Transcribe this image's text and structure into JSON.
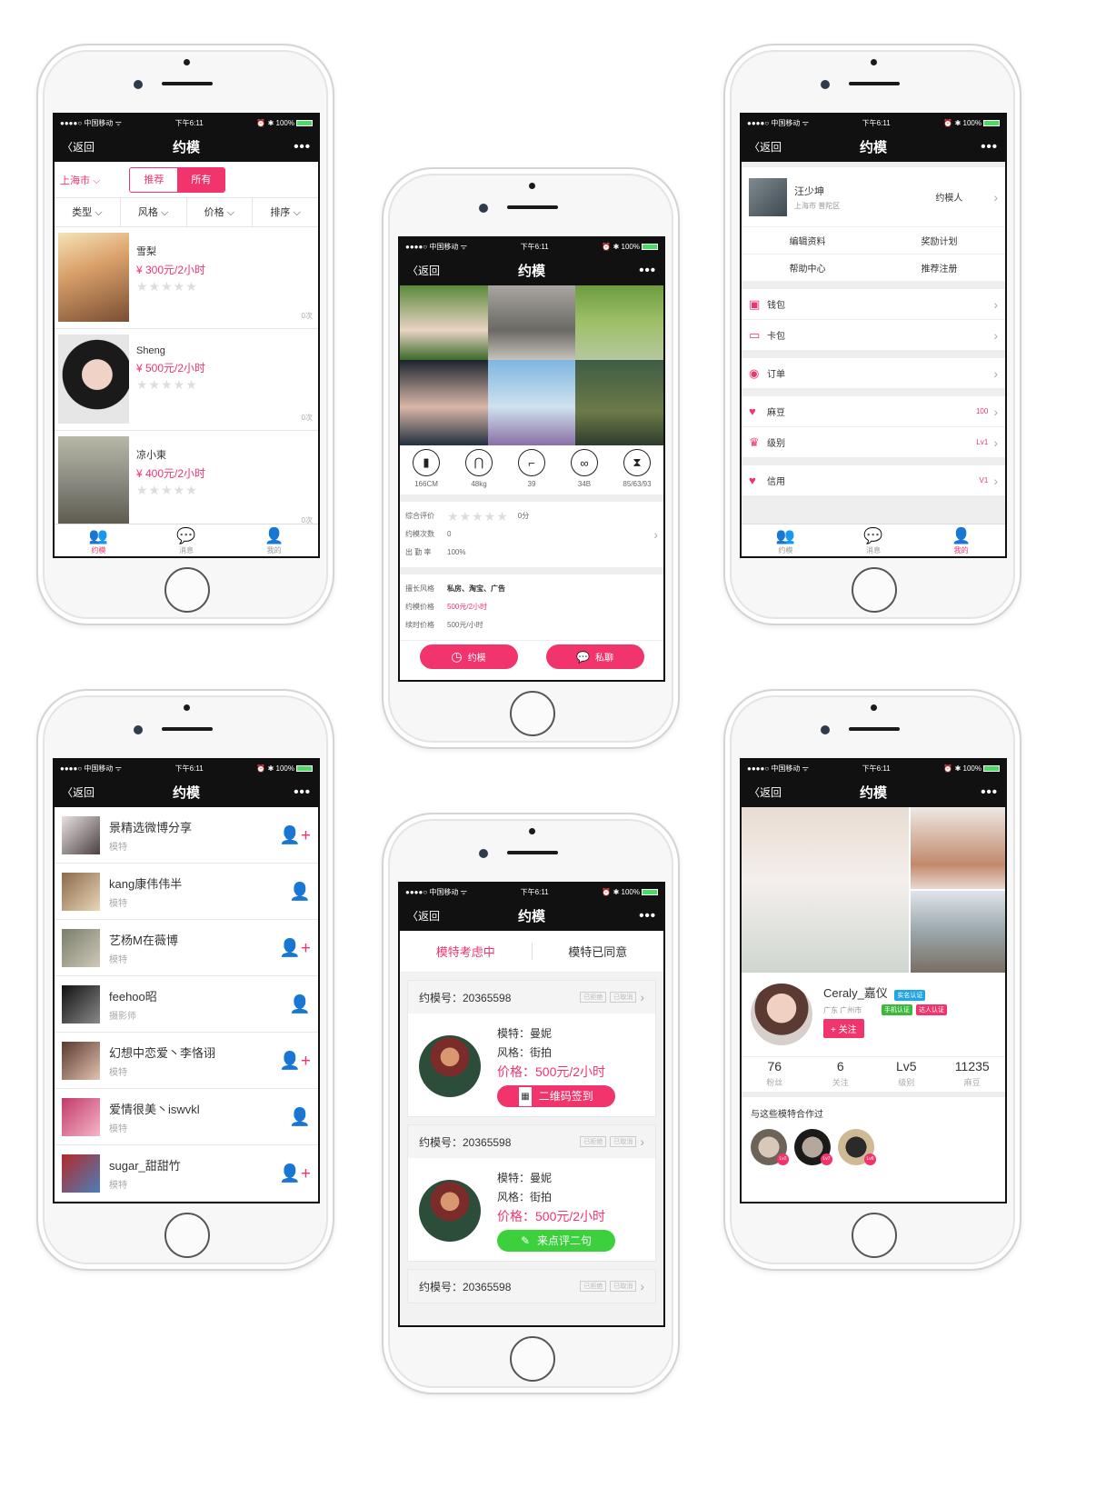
{
  "status": {
    "carrier": "●●●●○ 中国移动 ᯤ",
    "time": "下午6:11",
    "battery": "⏰ ✱ 100%"
  },
  "nav": {
    "back": "〈返回",
    "title": "约模",
    "more": "•••"
  },
  "tabbar": {
    "items": [
      "约模",
      "消息",
      "我的"
    ]
  },
  "phone1": {
    "city": "上海市 ⌵",
    "segments": [
      "推荐",
      "所有"
    ],
    "sorts": [
      "类型 ⌵",
      "风格 ⌵",
      "价格 ⌵",
      "排序 ⌵"
    ],
    "models": [
      {
        "name": "雪梨",
        "price": "¥ 300元/2小时",
        "stars": "★★★★★",
        "count": "0次"
      },
      {
        "name": "Sheng",
        "price": "¥ 500元/2小时",
        "stars": "★★★★★",
        "count": "0次"
      },
      {
        "name": "凉小東",
        "price": "¥ 400元/2小时",
        "stars": "★★★★★",
        "count": "0次"
      }
    ]
  },
  "phone2": {
    "specs": [
      {
        "icon": "▮",
        "label": "166CM"
      },
      {
        "icon": "⋂",
        "label": "48kg"
      },
      {
        "icon": "⌐",
        "label": "39"
      },
      {
        "icon": "∞",
        "label": "34B"
      },
      {
        "icon": "⧗",
        "label": "85/63/93"
      }
    ],
    "rating_label": "综合评价",
    "rating_stars": "★★★★★",
    "rating_value": "0分",
    "booking_label": "约模次数",
    "booking_value": "0",
    "attendance_label": "出 勤 率",
    "attendance_value": "100%",
    "style_label": "擅长风格",
    "style_value": "私房、淘宝、广告",
    "price_label": "约模价格",
    "price_value": "500元/2小时",
    "extra_label": "续时价格",
    "extra_value": "500元/小时",
    "btn_book": "约模",
    "btn_chat": "私聊"
  },
  "phone3": {
    "user_name": "汪少坤",
    "user_loc": "上海市 普陀区",
    "user_role": "约模人",
    "links1": [
      "编辑资料",
      "奖励计划"
    ],
    "links2": [
      "帮助中心",
      "推荐注册"
    ],
    "rows": [
      {
        "icon": "▣",
        "label": "钱包",
        "value": ""
      },
      {
        "icon": "▭",
        "label": "卡包",
        "value": ""
      },
      {
        "icon": "◉",
        "label": "订单",
        "value": ""
      },
      {
        "icon": "♥",
        "label": "麻豆",
        "value": "100"
      },
      {
        "icon": "♛",
        "label": "级别",
        "value": "Lv1"
      },
      {
        "icon": "♥",
        "label": "信用",
        "value": "V1"
      }
    ]
  },
  "phone4": {
    "items": [
      {
        "name": "景精选微博分享",
        "role": "模特"
      },
      {
        "name": "kang康伟伟半",
        "role": "模特"
      },
      {
        "name": "艺杨M在薇博",
        "role": "模特"
      },
      {
        "name": "feehoo昭",
        "role": "摄影师"
      },
      {
        "name": "幻想中恋爱丶李恪诩",
        "role": "模特"
      },
      {
        "name": "爱情很美丶iswvkl",
        "role": "模特"
      },
      {
        "name": "sugar_甜甜竹",
        "role": "模特"
      }
    ]
  },
  "phone5": {
    "tabs": [
      "模特考虑中",
      "模特已同意"
    ],
    "order_label": "约模号：20365598",
    "tag_rejected": "已拒绝",
    "tag_cancelled": "已取消",
    "model": "模特：曼妮",
    "style": "风格：街拍",
    "price": "价格：500元/2小时",
    "btn_qr": "二维码签到",
    "btn_review": "来点评二句"
  },
  "phone6": {
    "name": "Ceraly_嘉仪",
    "loc": "广东 广州市",
    "badge_real": "实名认证",
    "badge_phone": "手机认证",
    "badge_talent": "达人认证",
    "follow": "+ 关注",
    "stats": [
      {
        "value": "76",
        "label": "粉丝"
      },
      {
        "value": "6",
        "label": "关注"
      },
      {
        "value": "Lv5",
        "label": "级别"
      },
      {
        "value": "11235",
        "label": "麻豆"
      }
    ],
    "coop_title": "与这些模特合作过",
    "coop_levels": [
      "Lv2",
      "Lv7",
      "Lv8"
    ]
  },
  "colors": {
    "accent": "#f2346c",
    "green": "#3cd13c",
    "nav": "#111111"
  }
}
